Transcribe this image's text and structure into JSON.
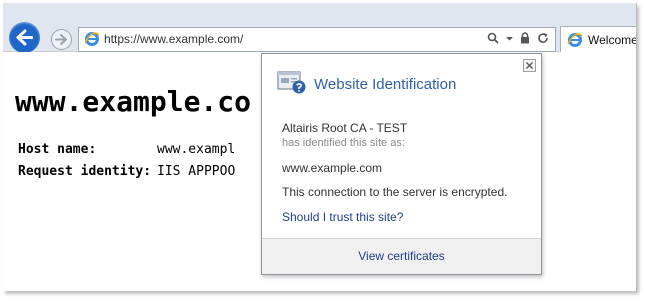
{
  "toolbar": {
    "address_url": "https://www.example.com/",
    "tab_title": "Welcome",
    "icons": {
      "back": "back-arrow-icon",
      "forward": "forward-arrow-icon",
      "site": "ie-logo-icon",
      "search": "search-icon",
      "dropdown": "chevron-down-icon",
      "lock": "lock-icon",
      "refresh": "refresh-icon"
    },
    "colors": {
      "back_button": "#1e66c8",
      "toolbar_bg": "#dfe6f0"
    }
  },
  "page": {
    "heading": "www.example.co",
    "rows": [
      {
        "label": "Host name:",
        "value": "www.exampl"
      },
      {
        "label": "Request identity:",
        "value": "IIS APPPOO"
      }
    ]
  },
  "popup": {
    "title": "Website Identification",
    "issuer": "Altairis Root CA - TEST",
    "identified_text": "has identified this site as:",
    "domain": "www.example.com",
    "encryption_text": "This connection to the server is encrypted.",
    "trust_link": "Should I trust this site?",
    "view_certificates": "View certificates",
    "icons": {
      "certificate": "certificate-icon",
      "close": "close-icon"
    },
    "colors": {
      "title": "#2e62a8",
      "link": "#1f3f8f"
    }
  }
}
